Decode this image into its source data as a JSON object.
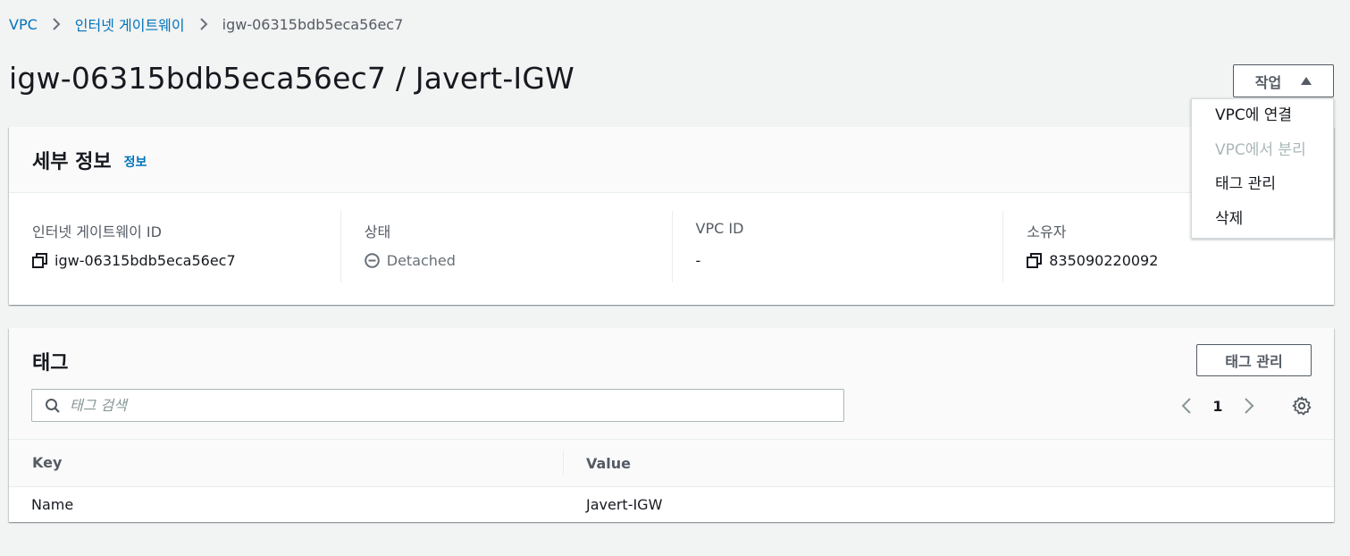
{
  "breadcrumb": {
    "items": [
      "VPC",
      "인터넷 게이트웨이"
    ],
    "current": "igw-06315bdb5eca56ec7"
  },
  "page_title": "igw-06315bdb5eca56ec7 / Javert-IGW",
  "actions": {
    "label": "작업",
    "menu": [
      {
        "label": "VPC에 연결",
        "disabled": false
      },
      {
        "label": "VPC에서 분리",
        "disabled": true
      },
      {
        "label": "태그 관리",
        "disabled": false
      },
      {
        "label": "삭제",
        "disabled": false
      }
    ]
  },
  "details": {
    "title": "세부 정보",
    "info_link": "정보",
    "columns": [
      {
        "label": "인터넷 게이트웨이 ID",
        "value": "igw-06315bdb5eca56ec7"
      },
      {
        "label": "상태",
        "value": "Detached"
      },
      {
        "label": "VPC ID",
        "value": "-"
      },
      {
        "label": "소유자",
        "value": "835090220092"
      }
    ]
  },
  "tags": {
    "title": "태그",
    "manage_button": "태그 관리",
    "search_placeholder": "태그 검색",
    "page": "1",
    "table": {
      "headers": [
        "Key",
        "Value"
      ],
      "rows": [
        [
          "Name",
          "Javert-IGW"
        ]
      ]
    }
  },
  "icons": {
    "copy": "copy-icon",
    "status": "minus-circle-icon",
    "search": "search-icon",
    "settings": "gear-icon",
    "caret": "caret-up-icon"
  },
  "colors": {
    "link": "#0073bb",
    "text": "#16191f",
    "muted": "#545b64",
    "background": "#f2f3f3"
  }
}
